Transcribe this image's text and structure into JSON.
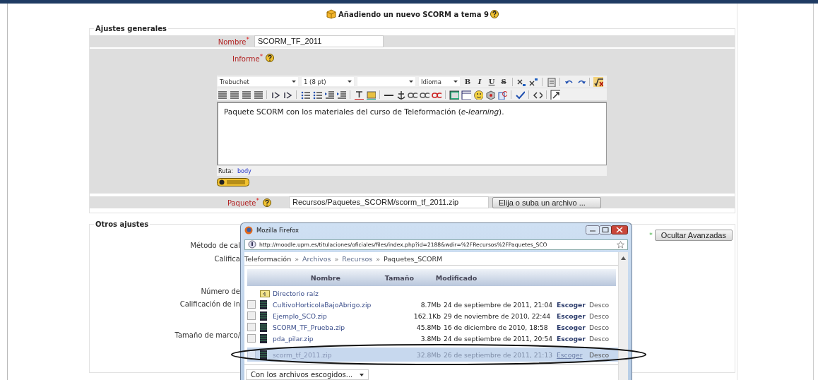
{
  "page_title": {
    "text": "Añadiendo un nuevo SCORM a tema 9"
  },
  "general_settings": {
    "legend": "Ajustes generales",
    "name_field": {
      "label": "Nombre",
      "required_mark": "*",
      "value": "SCORM_TF_2011"
    },
    "description_field": {
      "label": "Informe",
      "required_mark": "*"
    },
    "editor": {
      "font": "Trebuchet",
      "size": "1 (8 pt)",
      "language": "Idioma",
      "format_buttons": [
        "B",
        "I",
        "U",
        "S"
      ],
      "content": "Paquete SCORM con los materiales del curso de Teleformación (*e-learning*).",
      "path_label": "Ruta:",
      "path_link": "body"
    },
    "package_field": {
      "label": "Paquete",
      "required_mark": "*",
      "value": "Recursos/Paquetes_SCORM/scorm_tf_2011.zip",
      "button": "Elija o suba un archivo ..."
    }
  },
  "other_settings": {
    "legend": "Otros ajustes",
    "advanced_mark": "*",
    "advanced_button": "Ocultar Avanzadas",
    "labels": [
      "Método de cal",
      "Califica",
      "Número de",
      "Calificación de in",
      "Tamaño de marco/"
    ]
  },
  "file_window": {
    "title": "Mozilla Firefox",
    "url": "http://moodle.upm.es/titulaciones/oficiales/files/index.php?id=2188&wdir=%2FRecursos%2FPaquetes_SCO",
    "breadcrumb": [
      {
        "kind": "current",
        "text": "Teleformación"
      },
      {
        "kind": "separator",
        "text": "»"
      },
      {
        "kind": "link",
        "text": "Archivos"
      },
      {
        "kind": "separator",
        "text": "»"
      },
      {
        "kind": "link",
        "text": "Recursos"
      },
      {
        "kind": "separator",
        "text": "»"
      },
      {
        "kind": "current",
        "text": "Paquetes_SCORM"
      }
    ],
    "columns": [
      "Nombre",
      "Tamaño",
      "Modificado"
    ],
    "parent_folder": {
      "name": "Directorio raíz"
    },
    "files": [
      {
        "name": "CultivoHorticolaBajoAbrigo.zip",
        "size": "8.7Mb",
        "modified": "24 de septiembre de 2011, 21:04",
        "choose": "Escoger",
        "download": "Desco",
        "checked": false,
        "selected": false
      },
      {
        "name": "Ejemplo_SCO.zip",
        "size": "162.1Kb",
        "modified": "29 de noviembre de 2010, 22:44",
        "choose": "Escoger",
        "download": "Desco",
        "checked": false,
        "selected": false
      },
      {
        "name": "SCORM_TF_Prueba.zip",
        "size": "45.8Mb",
        "modified": "16 de diciembre de 2010, 18:58",
        "choose": "Escoger",
        "download": "Desco",
        "checked": false,
        "selected": false
      },
      {
        "name": "pda_pilar.zip",
        "size": "3.8Mb",
        "modified": "24 de septiembre de 2011, 20:54",
        "choose": "Escoger",
        "download": "Desco",
        "checked": false,
        "selected": false
      },
      {
        "name": "scorm_tf_2011.zip",
        "size": "32.8Mb",
        "modified": "26 de septiembre de 2011, 21:13",
        "choose": "Escoger",
        "download": "Desco",
        "checked": false,
        "selected": true
      }
    ],
    "action_select": "Con los archivos escogidos..."
  }
}
